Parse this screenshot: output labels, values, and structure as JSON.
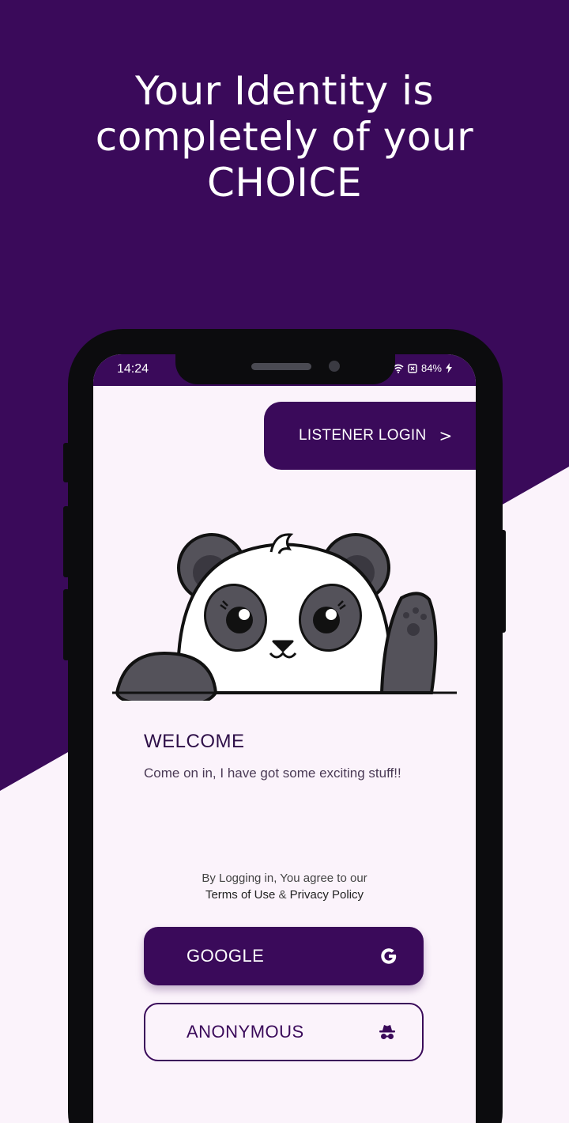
{
  "headline": "Your Identity is\ncompletely of your\nCHOICE",
  "status_bar": {
    "time": "14:24",
    "battery": "84%"
  },
  "listener_login": {
    "label": "LISTENER LOGIN",
    "chevron": ">"
  },
  "welcome": {
    "title": "WELCOME",
    "subtitle": "Come on in, I have got some exciting stuff!!"
  },
  "agreement": {
    "prefix": "By Logging in, You agree to our",
    "terms": "Terms of Use",
    "joiner": "&",
    "privacy": "Privacy Policy"
  },
  "buttons": {
    "google": "GOOGLE",
    "anonymous": "ANONYMOUS"
  },
  "icons": {
    "google": "google-icon",
    "anonymous": "incognito-icon",
    "chevron": "chevron-right-icon"
  },
  "colors": {
    "brand_purple": "#3a0a5a",
    "screen_bg": "#fbf3fb",
    "panda_gray": "#54525a"
  }
}
